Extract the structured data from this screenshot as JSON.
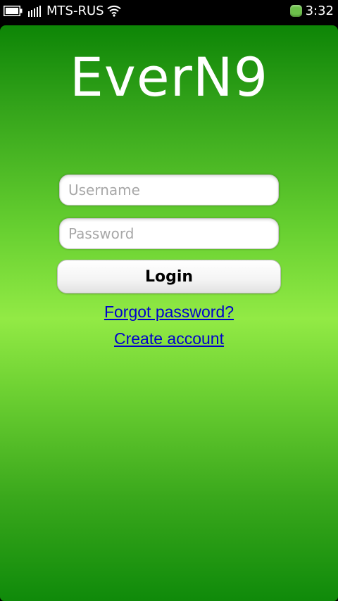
{
  "status_bar": {
    "carrier": "MTS-RUS",
    "time": "3:32",
    "icons": [
      "battery-icon",
      "signal-icon",
      "wifi-icon",
      "presence-icon"
    ]
  },
  "app": {
    "title": "EverN9"
  },
  "login_form": {
    "username_placeholder": "Username",
    "password_placeholder": "Password",
    "login_label": "Login",
    "forgot_password_label": "Forgot password?",
    "create_account_label": "Create account"
  },
  "colors": {
    "background_top": "#0d8506",
    "background_mid": "#92ea45",
    "background_bottom": "#0f8a0a",
    "link": "#0000cc",
    "presence": "#6cc04a"
  }
}
